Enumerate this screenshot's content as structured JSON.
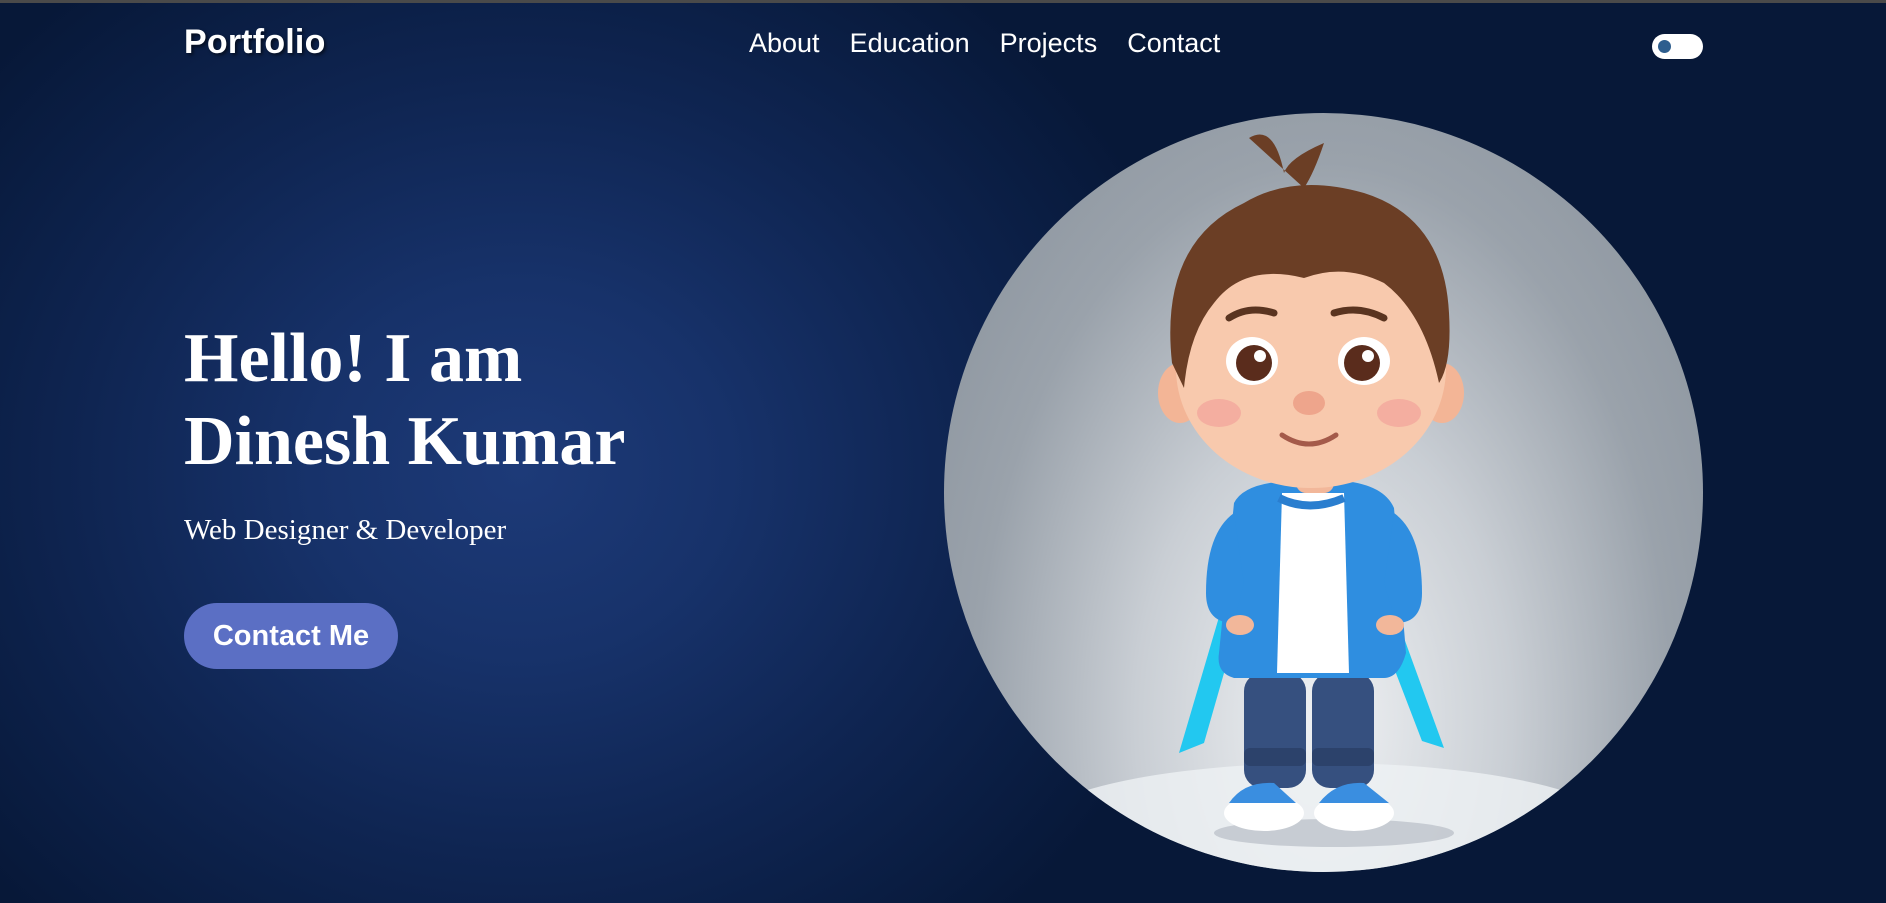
{
  "brand": {
    "logo": "Portfolio"
  },
  "nav": {
    "items": [
      {
        "label": "About"
      },
      {
        "label": "Education"
      },
      {
        "label": "Projects"
      },
      {
        "label": "Contact"
      }
    ]
  },
  "theme_toggle": {
    "icon": "theme-toggle-icon",
    "state": "off"
  },
  "hero": {
    "title": "Hello! I am Dinesh Kumar",
    "subtitle": "Web Designer & Developer",
    "cta_label": "Contact Me"
  },
  "portrait": {
    "icon": "cartoon-boy-avatar"
  },
  "colors": {
    "background": "#0f2552",
    "button": "#5b6fc4",
    "text": "#ffffff"
  }
}
